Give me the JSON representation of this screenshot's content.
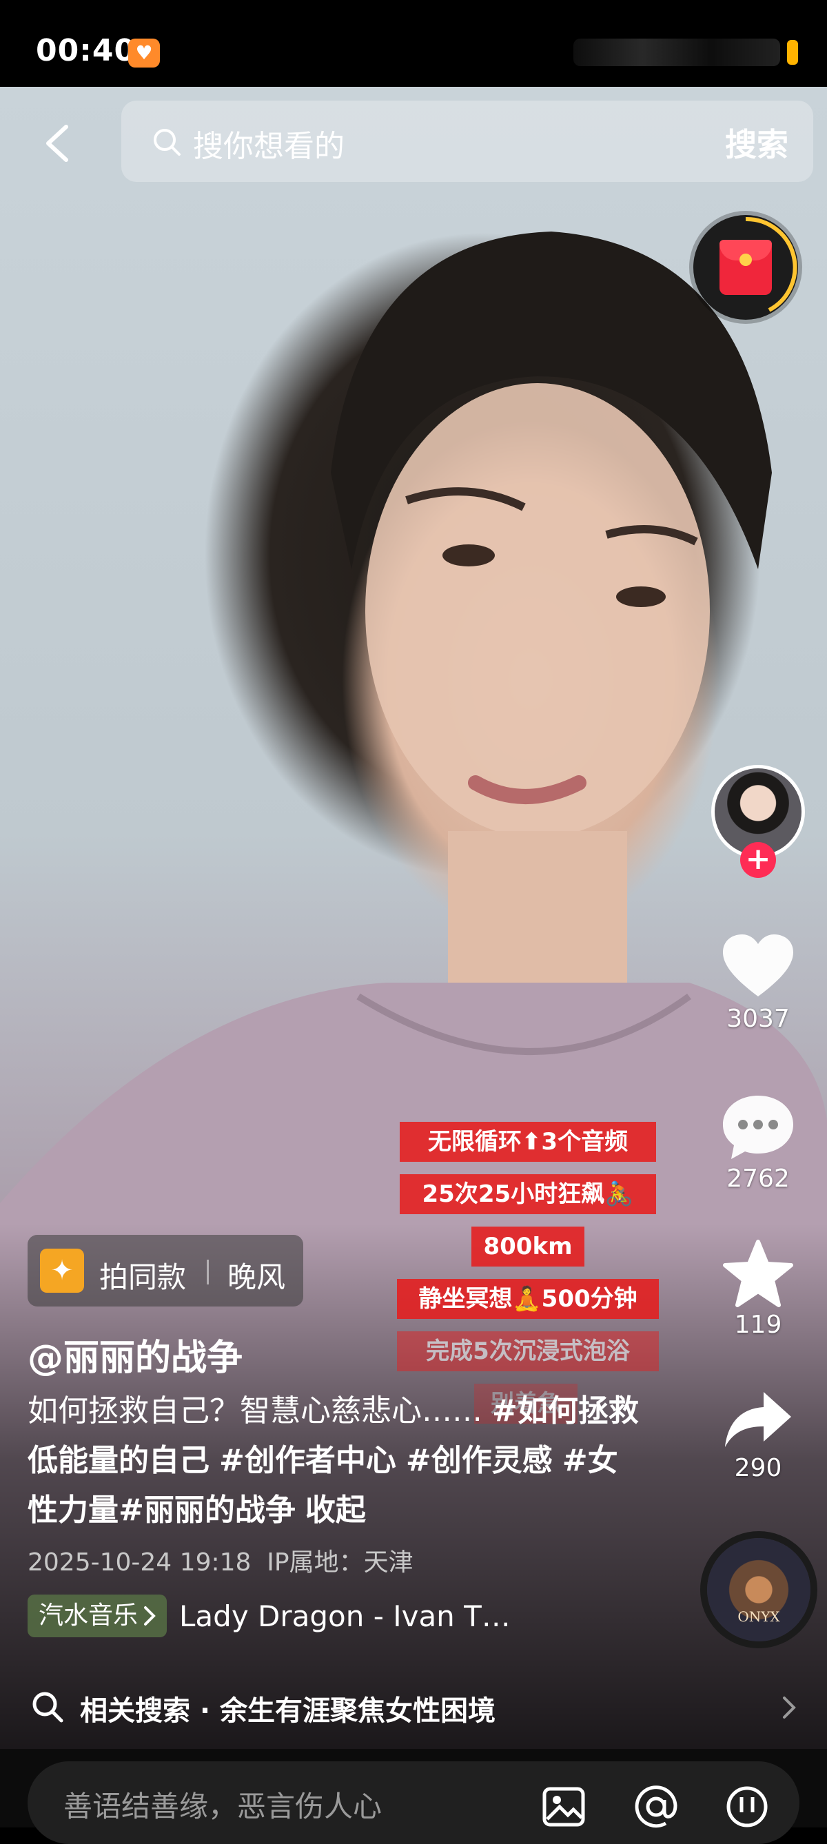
{
  "status_bar": {
    "time": "00:40"
  },
  "search": {
    "placeholder": "搜你想看的",
    "button": "搜索"
  },
  "right_rail": {
    "likes": "3037",
    "comments": "2762",
    "favorites": "119",
    "shares": "290"
  },
  "overlay_texts": [
    "无限循环⬆3个音频",
    "25次25小时狂飙🚴",
    "800km",
    "静坐冥想🧘500分钟",
    "完成5次沉浸式泡浴",
    "别着急"
  ],
  "same_style": {
    "label": "拍同款",
    "song": "晚风"
  },
  "post": {
    "author": "@丽丽的战争",
    "caption_text": "如何拯救自己？智慧心慈悲心…… ",
    "hashtags": [
      "#如何拯救低能量的自己",
      "#创作者中心",
      "#创作灵感",
      "#女性力量#丽丽的战争"
    ],
    "collapse": "收起",
    "date_time": "2025-10-24 19:18",
    "ip_location": "IP属地：天津"
  },
  "music": {
    "app": "汽水音乐",
    "track": "Lady Dragon - Ivan T…"
  },
  "related": {
    "text": "相关搜索 · 余生有涯聚焦女性困境"
  },
  "comment": {
    "placeholder": "善语结善缘，恶言伤人心"
  },
  "colors": {
    "accent_red": "#fe2c55",
    "overlay_red": "#e81a1a",
    "music_badge": "#566e44"
  },
  "icons": [
    "back-icon",
    "search-icon",
    "red-packet-icon",
    "heart-icon",
    "comment-icon",
    "star-icon",
    "share-icon",
    "music-disc-icon",
    "image-icon",
    "at-icon",
    "emoji-icon",
    "chevron-right-icon"
  ]
}
